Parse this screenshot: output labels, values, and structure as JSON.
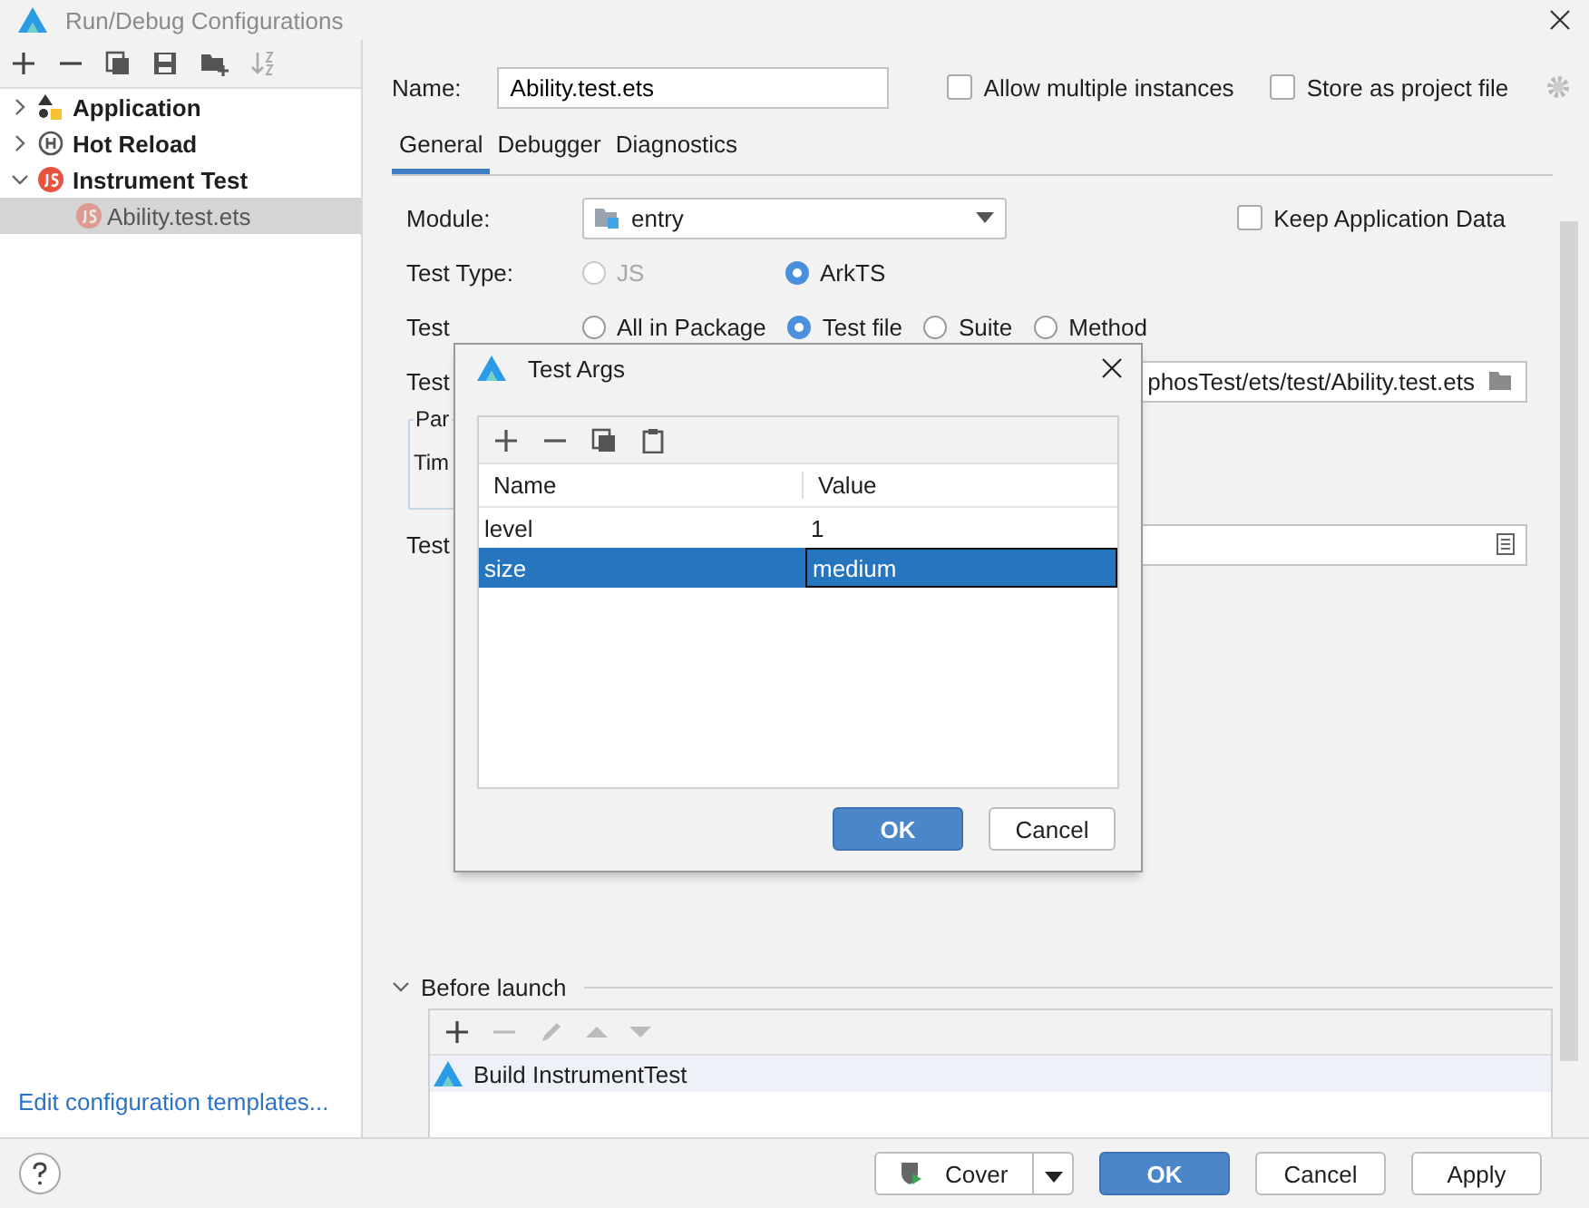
{
  "window": {
    "title": "Run/Debug Configurations"
  },
  "sidebar": {
    "tree": [
      {
        "label": "Application",
        "kind": "application",
        "expanded": false,
        "selected": false
      },
      {
        "label": "Hot Reload",
        "kind": "hotreload",
        "expanded": false,
        "selected": false
      },
      {
        "label": "Instrument Test",
        "kind": "js",
        "expanded": true,
        "selected": false,
        "children": [
          {
            "label": "Ability.test.ets",
            "kind": "js",
            "selected": true
          }
        ]
      }
    ],
    "link": "Edit configuration templates..."
  },
  "name_field": {
    "label": "Name:",
    "value": "Ability.test.ets"
  },
  "options": [
    {
      "label": "Allow multiple instances",
      "checked": false
    },
    {
      "label": "Store as project file",
      "checked": false
    }
  ],
  "tabs": [
    {
      "label": "General",
      "selected": true
    },
    {
      "label": "Debugger",
      "selected": false
    },
    {
      "label": "Diagnostics",
      "selected": false
    }
  ],
  "form": {
    "module": {
      "label": "Module:",
      "value": "entry"
    },
    "keep_data": {
      "label": "Keep Application Data",
      "checked": false
    },
    "test_type": {
      "label": "Test Type:",
      "options": [
        {
          "label": "JS",
          "selected": false,
          "disabled": true
        },
        {
          "label": "ArkTS",
          "selected": true,
          "disabled": false
        }
      ]
    },
    "test_scope": {
      "label": "Test",
      "options": [
        {
          "label": "All in Package",
          "selected": false,
          "disabled": false
        },
        {
          "label": "Test file",
          "selected": true,
          "disabled": false
        },
        {
          "label": "Suite",
          "selected": false,
          "disabled": false
        },
        {
          "label": "Method",
          "selected": false,
          "disabled": false
        }
      ]
    },
    "test_file": {
      "label": "Test",
      "value": "phosTest/ets/test/Ability.test.ets"
    },
    "params": {
      "title": "Par",
      "timeout_label": "Tim"
    },
    "test_args": {
      "label": "Test"
    }
  },
  "before_launch": {
    "title": "Before launch",
    "expanded": true,
    "tasks": [
      {
        "label": "Build InstrumentTest",
        "selected": true
      }
    ]
  },
  "dialog": {
    "title": "Test Args",
    "columns": [
      "Name",
      "Value"
    ],
    "rows": [
      {
        "name": "level",
        "value": "1",
        "selected": false
      },
      {
        "name": "size",
        "value": "medium",
        "selected": true
      }
    ],
    "buttons": [
      {
        "label": "OK",
        "kind": "primary"
      },
      {
        "label": "Cancel",
        "kind": "secondary"
      }
    ]
  },
  "footer": {
    "buttons": [
      {
        "label": "Cover",
        "kind": "split"
      },
      {
        "label": "OK",
        "kind": "primary"
      },
      {
        "label": "Cancel",
        "kind": "secondary"
      },
      {
        "label": "Apply",
        "kind": "secondary"
      }
    ]
  }
}
